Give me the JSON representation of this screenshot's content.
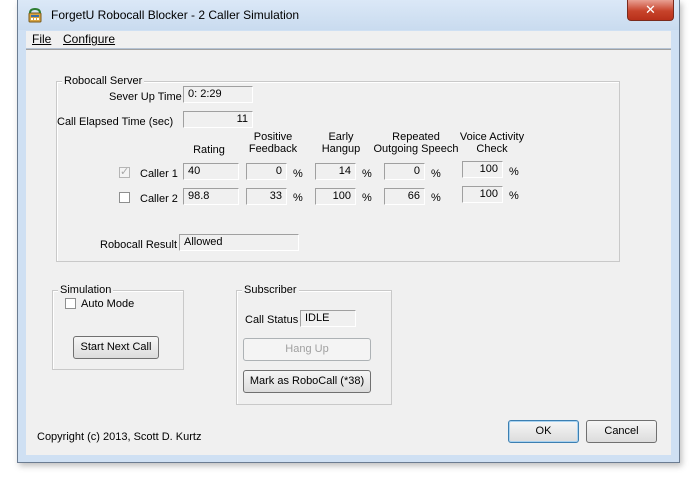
{
  "window": {
    "title": "ForgetU Robocall Blocker - 2 Caller Simulation",
    "close_glyph": "✕"
  },
  "menu": {
    "file": "File",
    "configure": "Configure"
  },
  "server": {
    "group_label": "Robocall Server",
    "uptime_label": "Sever Up Time",
    "uptime_value": "0: 2:29",
    "elapsed_label": "Call Elapsed Time (sec)",
    "elapsed_value": "11",
    "headers": {
      "rating": "Rating",
      "positive_feedback": "Positive Feedback",
      "early_hangup": "Early Hangup",
      "repeated_outgoing": "Repeated Outgoing Speech",
      "voice_activity": "Voice Activity Check"
    },
    "percent": "%",
    "callers": [
      {
        "name": "Caller 1",
        "checked": true,
        "rating": "40",
        "positive_feedback": "0",
        "early_hangup": "14",
        "repeated_outgoing": "0",
        "voice_activity": "100"
      },
      {
        "name": "Caller 2",
        "checked": false,
        "rating": "98.8",
        "positive_feedback": "33",
        "early_hangup": "100",
        "repeated_outgoing": "66",
        "voice_activity": "100"
      }
    ],
    "result_label": "Robocall Result",
    "result_value": "Allowed"
  },
  "simulation": {
    "group_label": "Simulation",
    "auto_mode_label": "Auto Mode",
    "start_next_call": "Start Next Call"
  },
  "subscriber": {
    "group_label": "Subscriber",
    "call_status_label": "Call Status",
    "call_status_value": "IDLE",
    "hang_up": "Hang Up",
    "mark_robocall": "Mark as RoboCall (*38)"
  },
  "footer": {
    "copyright": "Copyright (c) 2013, Scott D. Kurtz",
    "ok": "OK",
    "cancel": "Cancel"
  }
}
